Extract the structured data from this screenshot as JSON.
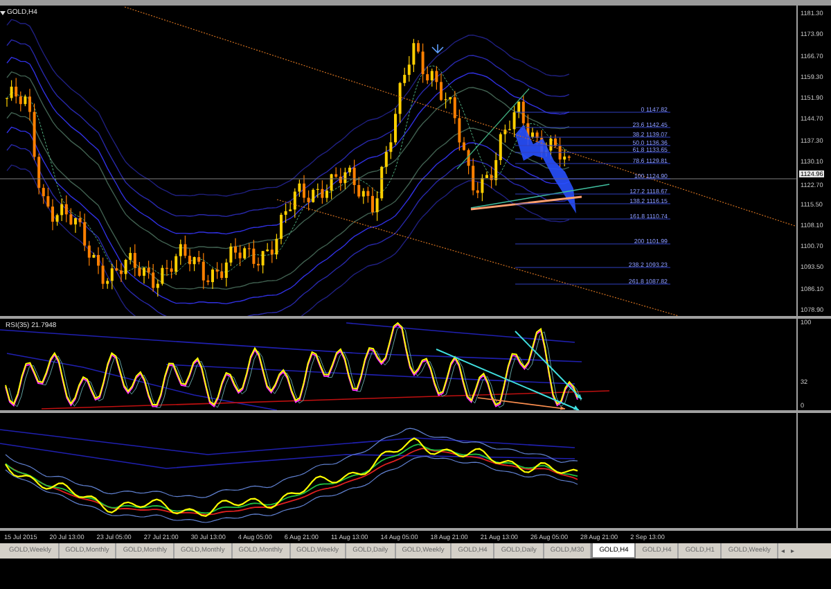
{
  "chart": {
    "title": "GOLD,H4",
    "price_axis": [
      "1181.30",
      "1173.90",
      "1166.70",
      "1159.30",
      "1151.90",
      "1144.70",
      "1137.30",
      "1130.10",
      "1122.70",
      "1115.50",
      "1108.10",
      "1100.70",
      "1093.50",
      "1086.10",
      "1078.90"
    ],
    "current_price": "1124.96",
    "fib_levels": [
      {
        "label": "0 1147.82"
      },
      {
        "label": "23.6 1142.45"
      },
      {
        "label": "38.2 1139.07"
      },
      {
        "label": "50.0 1136.36"
      },
      {
        "label": "61.8 1133.65"
      },
      {
        "label": "78.6 1129.81"
      },
      {
        "label": "100 1124.90"
      },
      {
        "label": "127.2 1118.67"
      },
      {
        "label": "138.2 1116.15"
      },
      {
        "label": "161.8 1110.74"
      },
      {
        "label": "200 1101.99"
      },
      {
        "label": "238.2 1093.23"
      },
      {
        "label": "261.8 1087.82"
      }
    ]
  },
  "rsi": {
    "label": "RSI(35) 21.7948",
    "axis": [
      "100",
      "32",
      "0"
    ]
  },
  "time_axis": [
    "15 Jul 2015",
    "20 Jul 13:00",
    "23 Jul 05:00",
    "27 Jul 21:00",
    "30 Jul 13:00",
    "4 Aug 05:00",
    "6 Aug 21:00",
    "11 Aug 13:00",
    "14 Aug 05:00",
    "18 Aug 21:00",
    "21 Aug 13:00",
    "26 Aug 05:00",
    "28 Aug 21:00",
    "2 Sep 13:00"
  ],
  "tabs": [
    {
      "label": "GOLD,Weekly",
      "selected": false
    },
    {
      "label": "GOLD,Monthly",
      "selected": false
    },
    {
      "label": "GOLD,Monthly",
      "selected": false
    },
    {
      "label": "GOLD,Monthly",
      "selected": false
    },
    {
      "label": "GOLD,Monthly",
      "selected": false
    },
    {
      "label": "GOLD,Weekly",
      "selected": false
    },
    {
      "label": "GOLD,Daily",
      "selected": false
    },
    {
      "label": "GOLD,Weekly",
      "selected": false
    },
    {
      "label": "GOLD,H4",
      "selected": false
    },
    {
      "label": "GOLD,Daily",
      "selected": false
    },
    {
      "label": "GOLD,M30",
      "selected": false
    },
    {
      "label": "GOLD,H4",
      "selected": true
    },
    {
      "label": "GOLD,H4",
      "selected": false
    },
    {
      "label": "GOLD,H1",
      "selected": false
    },
    {
      "label": "GOLD,Weekly",
      "selected": false
    }
  ],
  "tab_scroll": [
    "◂",
    "▸"
  ]
}
